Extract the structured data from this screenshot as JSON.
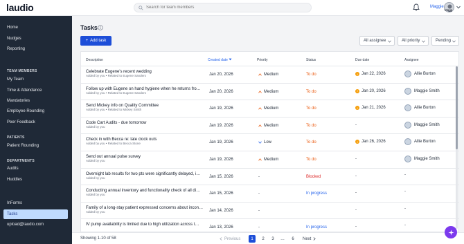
{
  "app": {
    "logo": "laudio",
    "search_placeholder": "Search for team members",
    "user_name": "Maggie",
    "user_avatar_label": "Magg"
  },
  "sidebar": {
    "top_items": [
      "Home",
      "Nudges",
      "Reporting"
    ],
    "sections": [
      {
        "title": "TEAM MEMBERS",
        "items": [
          "My Team",
          "Time & Attendance",
          "Mandatories",
          "Employee Rounding",
          "Peer Feedback"
        ]
      },
      {
        "title": "PATIENTS",
        "items": [
          "Patient Rounding"
        ]
      },
      {
        "title": "DEPARTMENTS",
        "items": [
          "Audits",
          "Huddles"
        ]
      }
    ],
    "bottom_items": [
      "InForms",
      "Tasks",
      "upload@laudio.com"
    ]
  },
  "page": {
    "title": "Tasks",
    "add_button": "Add task",
    "filters": [
      "All assignee",
      "All priority",
      "Pending"
    ]
  },
  "table": {
    "headers": [
      "Description",
      "Created date",
      "Priority",
      "Status",
      "Due date",
      "Assignee"
    ],
    "rows": [
      {
        "title": "Celebrate Eugene's recent wedding",
        "sub": "Added by you  •  Related to Eugene Sanders",
        "created": "Jan 20, 2026",
        "priority": "Medium",
        "priority_dir": "up",
        "status": "To do",
        "status_type": "todo",
        "due": "Jan 22, 2026",
        "due_warn": true,
        "assignee": "Allie Burton"
      },
      {
        "title": "Follow up with Eugene on hand hygiene when he returns fro…",
        "sub": "Added by you  •  Related to Eugene Sanders",
        "created": "Jan 20, 2026",
        "priority": "Medium",
        "priority_dir": "up",
        "status": "To do",
        "status_type": "todo",
        "due": "Jan 20, 2026",
        "due_warn": true,
        "assignee": "Maggie Smith"
      },
      {
        "title": "Send Mickey info on Quality Committee",
        "sub": "Added by you  •  Related to Mickey Smith",
        "created": "Jan 19, 2026",
        "priority": "Medium",
        "priority_dir": "up",
        "status": "To do",
        "status_type": "todo",
        "due": "Jan 21, 2026",
        "due_warn": true,
        "assignee": "Allie Burton"
      },
      {
        "title": "Code Cart Audits - due tomorrow",
        "sub": "Added by you",
        "created": "Jan 19, 2026",
        "priority": "Medium",
        "priority_dir": "up",
        "status": "To do",
        "status_type": "todo",
        "due": "-",
        "due_warn": false,
        "assignee": "Maggie Smith"
      },
      {
        "title": "Check in with Becca re: late clock outs",
        "sub": "Added by you  •  Related to Becca Stone",
        "created": "Jan 19, 2026",
        "priority": "Low",
        "priority_dir": "down",
        "status": "To do",
        "status_type": "todo",
        "due": "Jan 26, 2026",
        "due_warn": true,
        "assignee": "Allie Burton"
      },
      {
        "title": "Send out annual pulse survey",
        "sub": "Added by you",
        "created": "Jan 19, 2026",
        "priority": "Medium",
        "priority_dir": "up",
        "status": "To do",
        "status_type": "todo",
        "due": "-",
        "due_warn": false,
        "assignee": "Maggie Smith"
      },
      {
        "title": "Overnight lab results for two pts were significantly delayed, i…",
        "sub": "Added by you",
        "created": "Jan 15, 2026",
        "priority": "-",
        "priority_dir": "none",
        "status": "Blocked",
        "status_type": "blocked",
        "due": "-",
        "due_warn": false,
        "assignee": "-"
      },
      {
        "title": "Conducting annual inventory and functionality check of all di…",
        "sub": "Added by you",
        "created": "Jan 15, 2026",
        "priority": "-",
        "priority_dir": "none",
        "status": "In progress",
        "status_type": "progress",
        "due": "-",
        "due_warn": false,
        "assignee": "-"
      },
      {
        "title": "Family of a long-stay patient expressed concerns about incon…",
        "sub": "Added by you",
        "created": "Jan 14, 2026",
        "priority": "-",
        "priority_dir": "none",
        "status": "",
        "status_type": "none",
        "due": "-",
        "due_warn": false,
        "assignee": "-"
      },
      {
        "title": "IV pump availability is limited due to high utilization across t…",
        "sub": "",
        "created": "Jan 13, 2026",
        "priority": "-",
        "priority_dir": "none",
        "status": "In progress",
        "status_type": "progress",
        "due": "-",
        "due_warn": false,
        "assignee": "-"
      }
    ]
  },
  "pagination": {
    "showing": "Showing 1-10 of 58",
    "previous": "Previous",
    "pages": [
      "1",
      "2",
      "3",
      "…",
      "6"
    ],
    "next": "Next"
  },
  "colors": {
    "accent": "#1d4ed8",
    "todo": "#ea580c",
    "blocked": "#dc2626",
    "progress": "#2563eb",
    "warn": "#f59e0b"
  }
}
